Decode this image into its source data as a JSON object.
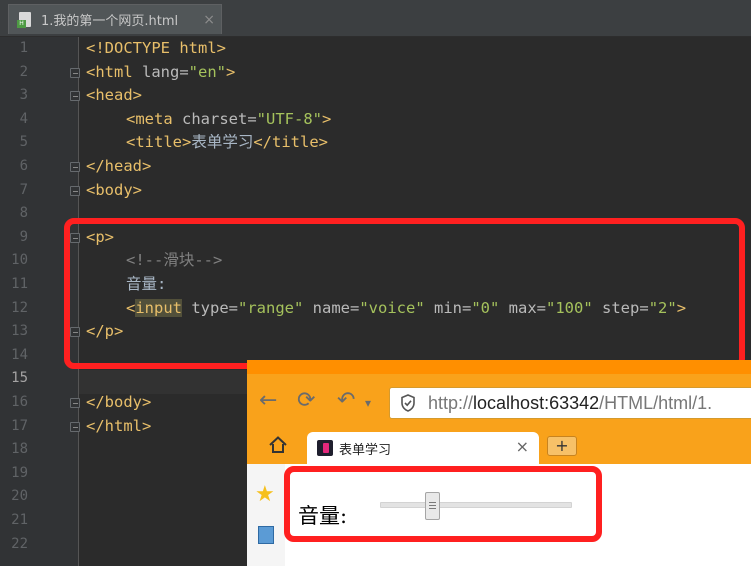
{
  "editor": {
    "tab_title": "1.我的第一个网页.html",
    "tab_close": "×",
    "file_badge": "H",
    "line_numbers": [
      "1",
      "2",
      "3",
      "4",
      "5",
      "6",
      "7",
      "8",
      "9",
      "10",
      "11",
      "12",
      "13",
      "14",
      "15",
      "16",
      "17",
      "18",
      "19",
      "20",
      "21",
      "22"
    ],
    "code": {
      "doctype": "<!DOCTYPE html>",
      "html_open": "<html",
      "lang_attr": " lang=",
      "lang_val": "\"en\"",
      "html_open_end": ">",
      "head_open": "<head>",
      "meta_open": "<meta",
      "charset_attr": " charset=",
      "charset_val": "\"UTF-8\"",
      "meta_end": ">",
      "title_open": "<title>",
      "title_text": "表单学习",
      "title_close": "</title>",
      "head_close": "</head>",
      "body_open": "<body>",
      "p_open": "<p>",
      "comment": "<!--滑块-->",
      "label_text": "音量:",
      "input_lt": "<",
      "input_tag": "input",
      "type_attr": " type=",
      "type_val": "\"range\"",
      "name_attr": " name=",
      "name_val": "\"voice\"",
      "min_attr": " min=",
      "min_val": "\"0\"",
      "max_attr": " max=",
      "max_val": "\"100\"",
      "step_attr": " step=",
      "step_val": "\"2\"",
      "input_gt": ">",
      "p_close": "</p>",
      "body_close": "</body>",
      "html_close": "</html>"
    }
  },
  "browser": {
    "url_scheme": "http://",
    "url_host": "localhost:63342",
    "url_path": "/HTML/html/1.",
    "tab_title": "表单学习",
    "tab_close": "×",
    "new_tab": "+",
    "back_icon": "←",
    "reload_icon": "⟳",
    "undo_icon": "↶",
    "menu_icon": "▾",
    "star_icon": "★",
    "volume_label": "音量:",
    "slider": {
      "min": 0,
      "max": 100,
      "step": 2,
      "value": 50
    }
  },
  "colors": {
    "highlight_box": "#ff2020",
    "browser_toolbar": "#f9a21b",
    "editor_bg": "#2b2b2b"
  }
}
